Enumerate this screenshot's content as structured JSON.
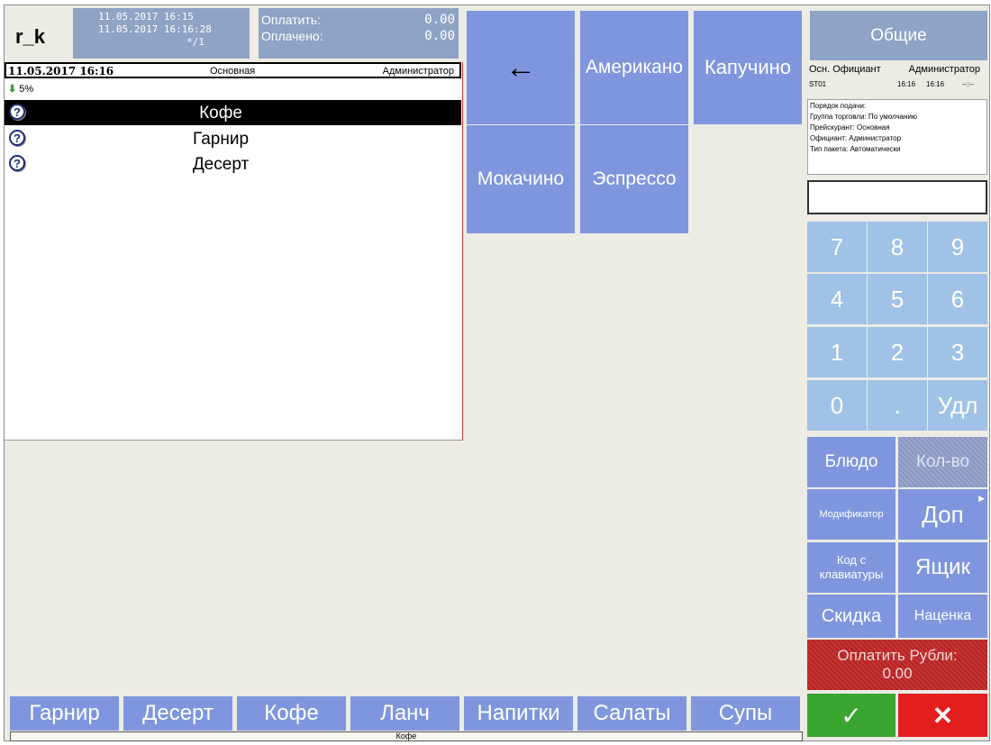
{
  "header": {
    "logo": "r_k",
    "opened_at": "11.05.2017 16:15",
    "updated_at": "11.05.2017 16:16:28",
    "guest_info": "*/1",
    "to_pay_label": "Оплатить:",
    "to_pay_value": "0.00",
    "paid_label": "Оплачено:",
    "paid_value": "0.00"
  },
  "order": {
    "date": "11.05.2017 16:16",
    "price_list": "Основная",
    "waiter": "Администратор",
    "discount": "5%",
    "items": [
      {
        "name": "Кофе",
        "selected": true
      },
      {
        "name": "Гарнир",
        "selected": false
      },
      {
        "name": "Десерт",
        "selected": false
      }
    ]
  },
  "products": {
    "back_icon": "arrow-left-icon",
    "back_glyph": "←",
    "items": [
      "Американо",
      "Капучино",
      "Мокачино",
      "Эспрессо"
    ]
  },
  "info": {
    "group_title": "Общие",
    "waiter_role": "Осн. Официант",
    "waiter_name": "Администратор",
    "station": "ST01",
    "time1": "16:16",
    "time2": "16:16",
    "time3": "--:--",
    "details": [
      "Порядок подачи:",
      "Группа торговли: По умолчанию",
      "Прейскурант: Основная",
      "Официант: Администратор",
      "Тип пакета: Автоматически"
    ],
    "input_value": ""
  },
  "numpad": {
    "keys": [
      "7",
      "8",
      "9",
      "4",
      "5",
      "6",
      "1",
      "2",
      "3",
      "0",
      ".",
      "Удл"
    ]
  },
  "functions": {
    "dish": "Блюдо",
    "qty": "Кол-во",
    "modifier": "Модификатор",
    "extra": "Доп",
    "keyboard_code": "Код с клавиатуры",
    "drawer": "Ящик",
    "discount": "Скидка",
    "markup": "Наценка",
    "pay_label": "Оплатить Рубли:",
    "pay_value": "0.00",
    "ok_glyph": "✓",
    "cancel_glyph": "✕"
  },
  "categories": [
    "Гарнир",
    "Десерт",
    "Кофе",
    "Ланч",
    "Напитки",
    "Салаты",
    "Супы"
  ],
  "status_bar": "Кофе",
  "colors": {
    "tile_blue": "#7f96de",
    "numpad_blue": "#9fc2e6",
    "pay_red": "#c93434",
    "ok_green": "#3aa52f",
    "cancel_red": "#e41e1e",
    "selected_row": "#000000"
  }
}
